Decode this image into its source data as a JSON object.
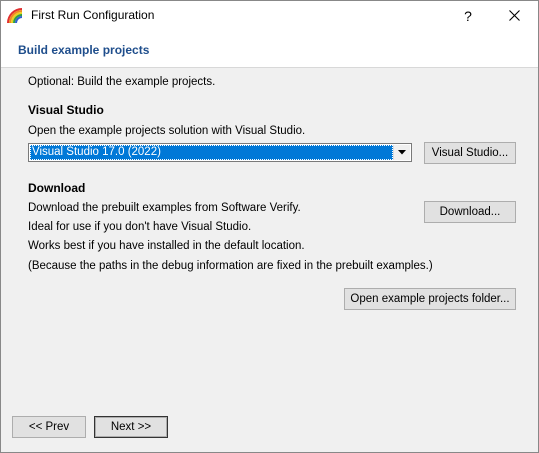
{
  "window": {
    "title": "First Run Configuration",
    "help_label": "?",
    "close_label": "✕"
  },
  "header": {
    "heading": "Build example projects"
  },
  "intro": "Optional: Build the example projects.",
  "visual_studio": {
    "title": "Visual Studio",
    "description": "Open the example projects solution with Visual Studio.",
    "selected": "Visual Studio 17.0 (2022)",
    "button_label": "Visual Studio..."
  },
  "download": {
    "title": "Download",
    "lines": [
      "Download the prebuilt examples from Software Verify.",
      "Ideal for use if you don't have Visual Studio.",
      "Works best if you have installed in the default location.",
      "(Because the paths in the debug information are fixed in the prebuilt examples.)"
    ],
    "button_label": "Download..."
  },
  "open_folder_label": "Open example projects folder...",
  "nav": {
    "prev_label": "<< Prev",
    "next_label": "Next >>"
  },
  "colors": {
    "heading": "#1f4e8c",
    "selection": "#0078d7"
  }
}
